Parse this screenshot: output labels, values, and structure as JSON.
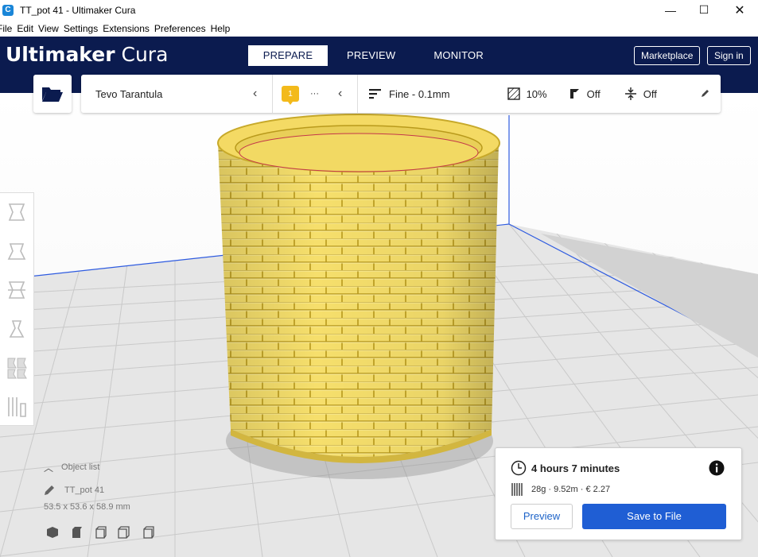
{
  "window": {
    "title": "TT_pot 41  - Ultimaker Cura",
    "minimize": "—",
    "maximize": "☐",
    "close": "✕"
  },
  "menu": [
    "File",
    "Edit",
    "View",
    "Settings",
    "Extensions",
    "Preferences",
    "Help"
  ],
  "header": {
    "logo_bold": "Ultimaker",
    "logo_light": " Cura",
    "tabs": [
      "PREPARE",
      "PREVIEW",
      "MONITOR"
    ],
    "active_tab": "PREPARE",
    "marketplace": "Marketplace",
    "signin": "Sign in"
  },
  "toolbar": {
    "printer": "Tevo Tarantula",
    "extruder_badge": "1",
    "extruder_more": "···",
    "profile": "Fine - 0.1mm",
    "infill": "10%",
    "support": "Off",
    "adhesion": "Off"
  },
  "object": {
    "list_label": "Object list",
    "name": "TT_pot 41",
    "dimensions": "53.5 x 53.6 x 58.9 mm"
  },
  "print": {
    "time": "4 hours 7 minutes",
    "material": "28g · 9.52m · € 2.27",
    "preview_label": "Preview",
    "save_label": "Save to File"
  },
  "colors": {
    "header_bg": "#0b1b4f",
    "model_yellow": "#f5dd6b",
    "accent_blue": "#1f5ed4"
  }
}
